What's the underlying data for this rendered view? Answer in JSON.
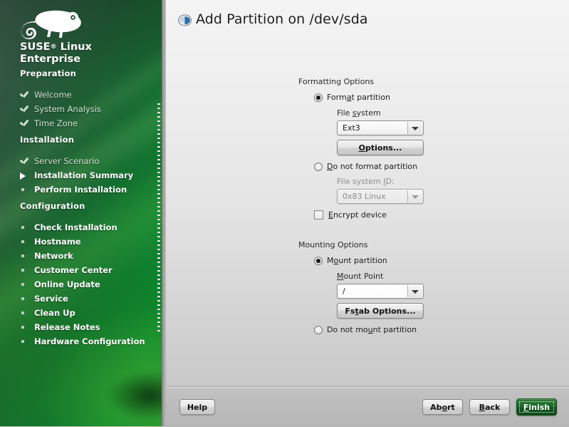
{
  "window": {
    "title": "Add Partition on /dev/sda",
    "title_icon": "yast-globe-icon"
  },
  "sidebar": {
    "brand_line1": "SUSE",
    "brand_reg": "®",
    "brand_line1b": " Linux",
    "brand_line2": "Enterprise",
    "logo_icon": "suse-chameleon-logo",
    "sections": [
      {
        "heading": "Preparation",
        "items": [
          {
            "label": "Welcome",
            "state": "done",
            "marker": "check-icon"
          },
          {
            "label": "System Analysis",
            "state": "done",
            "marker": "check-icon"
          },
          {
            "label": "Time Zone",
            "state": "done",
            "marker": "check-icon"
          }
        ]
      },
      {
        "heading": "Installation",
        "items": [
          {
            "label": "Server Scenario",
            "state": "done",
            "marker": "check-icon"
          },
          {
            "label": "Installation Summary",
            "state": "current",
            "marker": "triangle-icon"
          },
          {
            "label": "Perform Installation",
            "state": "todo",
            "marker": "bullet-icon"
          }
        ]
      },
      {
        "heading": "Configuration",
        "items": [
          {
            "label": "Check Installation",
            "state": "todo",
            "marker": "bullet-icon"
          },
          {
            "label": "Hostname",
            "state": "todo",
            "marker": "bullet-icon"
          },
          {
            "label": "Network",
            "state": "todo",
            "marker": "bullet-icon"
          },
          {
            "label": "Customer Center",
            "state": "todo",
            "marker": "bullet-icon"
          },
          {
            "label": "Online Update",
            "state": "todo",
            "marker": "bullet-icon"
          },
          {
            "label": "Service",
            "state": "todo",
            "marker": "bullet-icon"
          },
          {
            "label": "Clean Up",
            "state": "todo",
            "marker": "bullet-icon"
          },
          {
            "label": "Release Notes",
            "state": "todo",
            "marker": "bullet-icon"
          },
          {
            "label": "Hardware Configuration",
            "state": "todo",
            "marker": "bullet-icon"
          }
        ]
      }
    ]
  },
  "formatting": {
    "group_label": "Formatting Options",
    "format_radio": {
      "label": "Format partition",
      "mnemonic": "a",
      "selected": true
    },
    "filesystem_label": "File system",
    "filesystem_mnemonic": "s",
    "filesystem_value": "Ext3",
    "options_button": "Options...",
    "options_mnemonic": "O",
    "noformat_radio": {
      "label": "Do not format partition",
      "mnemonic": "D",
      "selected": false
    },
    "fsid_label": "File system ID:",
    "fsid_mnemonic": "I",
    "fsid_value": "0x83 Linux",
    "fsid_disabled": true,
    "encrypt_checkbox": {
      "label": "Encrypt device",
      "mnemonic": "E",
      "checked": false
    }
  },
  "mounting": {
    "group_label": "Mounting Options",
    "mount_radio": {
      "label": "Mount partition",
      "mnemonic": "o",
      "selected": true
    },
    "mountpoint_label": "Mount Point",
    "mountpoint_mnemonic": "M",
    "mountpoint_value": "/",
    "fstab_button": "Fstab Options...",
    "fstab_mnemonic": "t",
    "nomount_radio": {
      "label": "Do not mount partition",
      "mnemonic": "u",
      "selected": false
    }
  },
  "buttons": {
    "help": "Help",
    "abort": "Abort",
    "abort_mnemonic": "o",
    "back": "Back",
    "back_mnemonic": "B",
    "finish": "Finish",
    "finish_mnemonic": "F",
    "finish_default": true
  },
  "colors": {
    "sidebar_green_dark": "#12522c",
    "sidebar_green_light": "#0b8a2c",
    "panel_top": "#f4f4f4",
    "panel_bottom": "#c2c2c2",
    "finish_green": "#1d6a29",
    "text": "#1c1c1c",
    "disabled_text": "#8b8b8b"
  }
}
